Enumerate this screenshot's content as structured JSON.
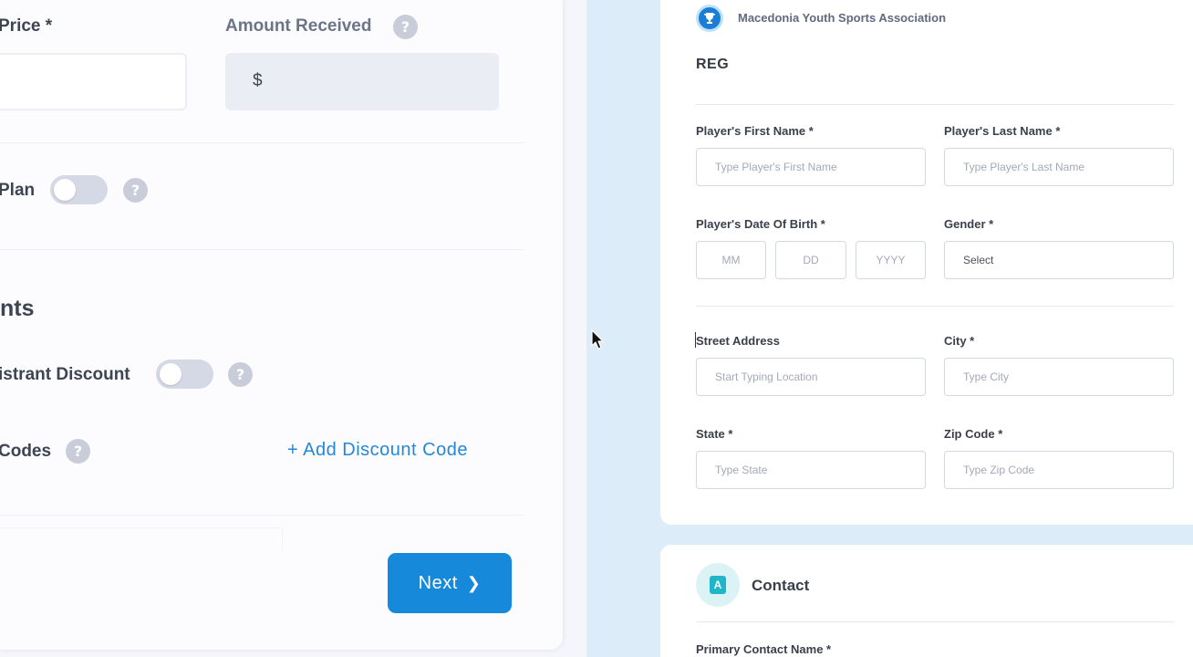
{
  "left_panel": {
    "price_label": "Price *",
    "amount_received_label": "Amount Received",
    "amount_prefix": "$",
    "help_glyph": "?",
    "plan_label": "Plan",
    "section_heading": "nts",
    "registrant_discount_label": "istrant Discount",
    "codes_label": "Codes",
    "add_discount_code": "+ Add Discount Code",
    "next_button": "Next",
    "next_chevron": "❯"
  },
  "form": {
    "org_name": "Macedonia Youth Sports Association",
    "org_logo_glyph": "🏆",
    "section_title": "REG",
    "fields": {
      "first_name": {
        "label": "Player's First Name *",
        "placeholder": "Type Player's First Name"
      },
      "last_name": {
        "label": "Player's Last Name *",
        "placeholder": "Type Player's Last Name"
      },
      "dob": {
        "label": "Player's Date Of Birth *",
        "month": "MM",
        "day": "DD",
        "year": "YYYY"
      },
      "gender": {
        "label": "Gender *",
        "value": "Select"
      },
      "street": {
        "label": "Street Address",
        "placeholder": "Start Typing Location"
      },
      "city": {
        "label": "City *",
        "placeholder": "Type City"
      },
      "state": {
        "label": "State *",
        "placeholder": "Type State"
      },
      "zip": {
        "label": "Zip Code *",
        "placeholder": "Type Zip Code"
      }
    }
  },
  "contact": {
    "title": "Contact",
    "icon_glyph": "A",
    "primary_contact_label": "Primary Contact Name *"
  },
  "icons": {
    "help": "question-mark-icon",
    "org_logo": "trophy-icon",
    "contact": "contact-card-icon",
    "pointer": "mouse-pointer-icon",
    "next": "chevron-right-icon"
  },
  "colors": {
    "primary": "#1689db",
    "link": "#2587d9",
    "stripe": "#dcedf9",
    "toggle_off": "#d5d9e6",
    "contact_accent": "#1fb6c9"
  }
}
